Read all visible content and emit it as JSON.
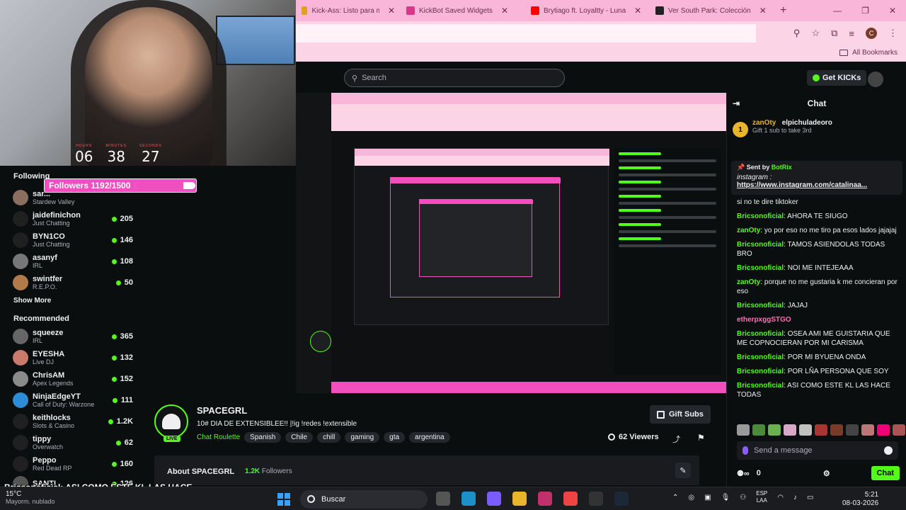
{
  "browser": {
    "tabs": [
      {
        "title": "Kick-Ass: Listo para machacar",
        "icon_color": "#e0a020"
      },
      {
        "title": "KickBot Saved Widgets",
        "icon_color": "#d7398a"
      },
      {
        "title": "Brytiago ft. Loyaltty - Luna",
        "icon_color": "#ff0000"
      },
      {
        "title": "Ver South Park: Colección",
        "icon_color": "#222222"
      }
    ],
    "bookmarks_label": "All Bookmarks",
    "profile_initial": "C"
  },
  "kick": {
    "search_placeholder": "Search",
    "get_kicks": "Get KICKs"
  },
  "webcam": {
    "timer": [
      {
        "label": "HOURS",
        "value": "06"
      },
      {
        "label": "MINUTES",
        "value": "38"
      },
      {
        "label": "SECONDS",
        "value": "27"
      }
    ],
    "followers_label": "Followers 1192/1500",
    "followers_current": 1192,
    "followers_goal": 1500
  },
  "sidebar": {
    "following_title": "Following",
    "following": [
      {
        "name": "sar...",
        "category": "Stardew Valley",
        "viewers": ""
      },
      {
        "name": "jaidefinichon",
        "category": "Just Chatting",
        "viewers": "205"
      },
      {
        "name": "BYN1CO",
        "category": "Just Chatting",
        "viewers": "146"
      },
      {
        "name": "asanyf",
        "category": "IRL",
        "viewers": "108"
      },
      {
        "name": "swintfer",
        "category": "R.E.P.O.",
        "viewers": "50"
      }
    ],
    "show_more": "Show More",
    "recommended_title": "Recommended",
    "recommended": [
      {
        "name": "squeeze",
        "category": "IRL",
        "viewers": "365"
      },
      {
        "name": "EYESHA",
        "category": "Live DJ",
        "viewers": "132"
      },
      {
        "name": "ChrisAM",
        "category": "Apex Legends",
        "viewers": "152"
      },
      {
        "name": "NinjaEdgeYT",
        "category": "Call of Duty: Warzone",
        "viewers": "111"
      },
      {
        "name": "keithlocks",
        "category": "Slots & Casino",
        "viewers": "1.2K"
      },
      {
        "name": "tippy",
        "category": "Overwatch",
        "viewers": "62"
      },
      {
        "name": "Peppo",
        "category": "Red Dead RP",
        "viewers": "160"
      },
      {
        "name": "SANTI",
        "category": "",
        "viewers": "126"
      }
    ]
  },
  "stream": {
    "channel": "SPACEGRL",
    "live_badge": "LIVE",
    "title": "10# DIA DE EXTENSIBLEE!! |!ig !redes !extensible",
    "category": "Chat Roulette",
    "tags": [
      "Spanish",
      "Chile",
      "chill",
      "gaming",
      "gta",
      "argentina"
    ],
    "gift_subs": "Gift Subs",
    "viewers": "62 Viewers",
    "about_title": "About SPACEGRL",
    "about_followers_count": "1.2K",
    "about_followers_label": "Followers"
  },
  "chat": {
    "title": "Chat",
    "gift_user1": "zanOty",
    "gift_user2": "elpichuladeoro",
    "gift_count": "1",
    "gift_line": "Gift 1 sub to take 3rd",
    "pinned_sent_by": "Sent by",
    "pinned_bot": "BotRix",
    "pinned_ig_label": "instagram :",
    "pinned_link": "https://www.instagram.com/catalinaa...",
    "messages": [
      {
        "user": "",
        "color": "#efeff1",
        "text": "si no te dire tiktoker"
      },
      {
        "user": "Bricsonoficial",
        "color": "#53fc18",
        "text": "AHORA TE SIUGO"
      },
      {
        "user": "zanOty",
        "color": "#53fc18",
        "text": "yo por eso no me tiro pa esos lados jajajaj"
      },
      {
        "user": "Bricsonoficial",
        "color": "#53fc18",
        "text": "TAMOS ASIENDOLAS TODAS BRO"
      },
      {
        "user": "Bricsonoficial",
        "color": "#53fc18",
        "text": "NOI ME INTEJEAAA"
      },
      {
        "user": "zanOty",
        "color": "#53fc18",
        "text": "porque no me gustaria k me concieran por eso"
      },
      {
        "user": "Bricsonoficial",
        "color": "#53fc18",
        "text": "JAJAJ"
      },
      {
        "user": "etherpxggSTGO",
        "color": "#ff6fb5",
        "text": ""
      },
      {
        "user": "Bricsonoficial",
        "color": "#53fc18",
        "text": "OSEA AMI ME GUISTARIA QUE ME COPNOCIERAN POR MI CARISMA"
      },
      {
        "user": "Bricsonoficial",
        "color": "#53fc18",
        "text": "POR MI BYUENA ONDA"
      },
      {
        "user": "Bricsonoficial",
        "color": "#53fc18",
        "text": "POR LÑA PERSONA QUE SOY"
      },
      {
        "user": "Bricsonoficial",
        "color": "#53fc18",
        "text": "ASI COMO ESTE KL LAS HACE TODAS"
      }
    ],
    "send_placeholder": "Send a message",
    "kicks_count": "0",
    "chat_button": "Chat"
  },
  "overlay": {
    "ticker_user": "Bricsonoficial",
    "ticker_text": ": ASI COMO ESTE KL LAS HACE TODAS"
  },
  "taskbar": {
    "weather_temp": "15°C",
    "weather_desc": "Mayorm. nublado",
    "search_label": "Buscar",
    "lang_top": "ESP",
    "lang_bottom": "LAA",
    "time": "5:21",
    "date": "08-03-2026"
  },
  "colors": {
    "kick_green": "#53fc18",
    "overlay_pink": "#f14fbf",
    "browser_pink": "#f9b6d8"
  }
}
